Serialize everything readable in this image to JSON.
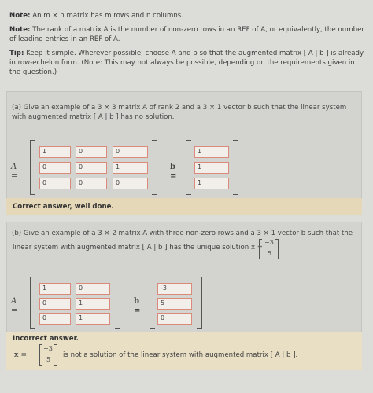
{
  "notes": {
    "note1_label": "Note:",
    "note1_text": "An m × n matrix has m rows and n columns.",
    "note2_label": "Note:",
    "note2_text": "The rank of a matrix A is the number of non-zero rows in an REF of A, or equivalently, the number of leading entries in an REF of A.",
    "tip_label": "Tip:",
    "tip_text": "Keep it simple. Wherever possible, choose A and b so that the augmented matrix [ A | b ] is already in row-echelon form. (Note: This may not always be possible, depending on the requirements given in the question.)"
  },
  "part_a": {
    "prompt": "(a) Give an example of a 3 × 3 matrix A of rank 2 and a 3 × 1 vector b such that the linear system with augmented matrix [ A | b ] has no solution.",
    "a_label": "A =",
    "b_label": "b =",
    "matrix_A": [
      [
        "1",
        "0",
        "0"
      ],
      [
        "0",
        "0",
        "1"
      ],
      [
        "0",
        "0",
        "0"
      ]
    ],
    "vector_b": [
      "1",
      "1",
      "1"
    ],
    "result": "Correct answer, well done."
  },
  "part_b": {
    "prompt_start": "(b) Give an example of a 3 × 2 matrix A with three non-zero rows and a 3 × 1 vector b such that the",
    "prompt_end": "linear system with augmented matrix [ A | b ] has the unique solution x =",
    "solution": [
      "−3",
      "5"
    ],
    "a_label": "A =",
    "b_label": "b =",
    "matrix_A": [
      [
        "1",
        "0"
      ],
      [
        "0",
        "1"
      ],
      [
        "0",
        "1"
      ]
    ],
    "vector_b": [
      "-3",
      "5",
      "0"
    ],
    "result_title": "Incorrect answer.",
    "result_x_label": "x =",
    "result_x": [
      "−3",
      "5"
    ],
    "result_text": "is not a solution of the linear system with augmented matrix [ A | b ]."
  }
}
